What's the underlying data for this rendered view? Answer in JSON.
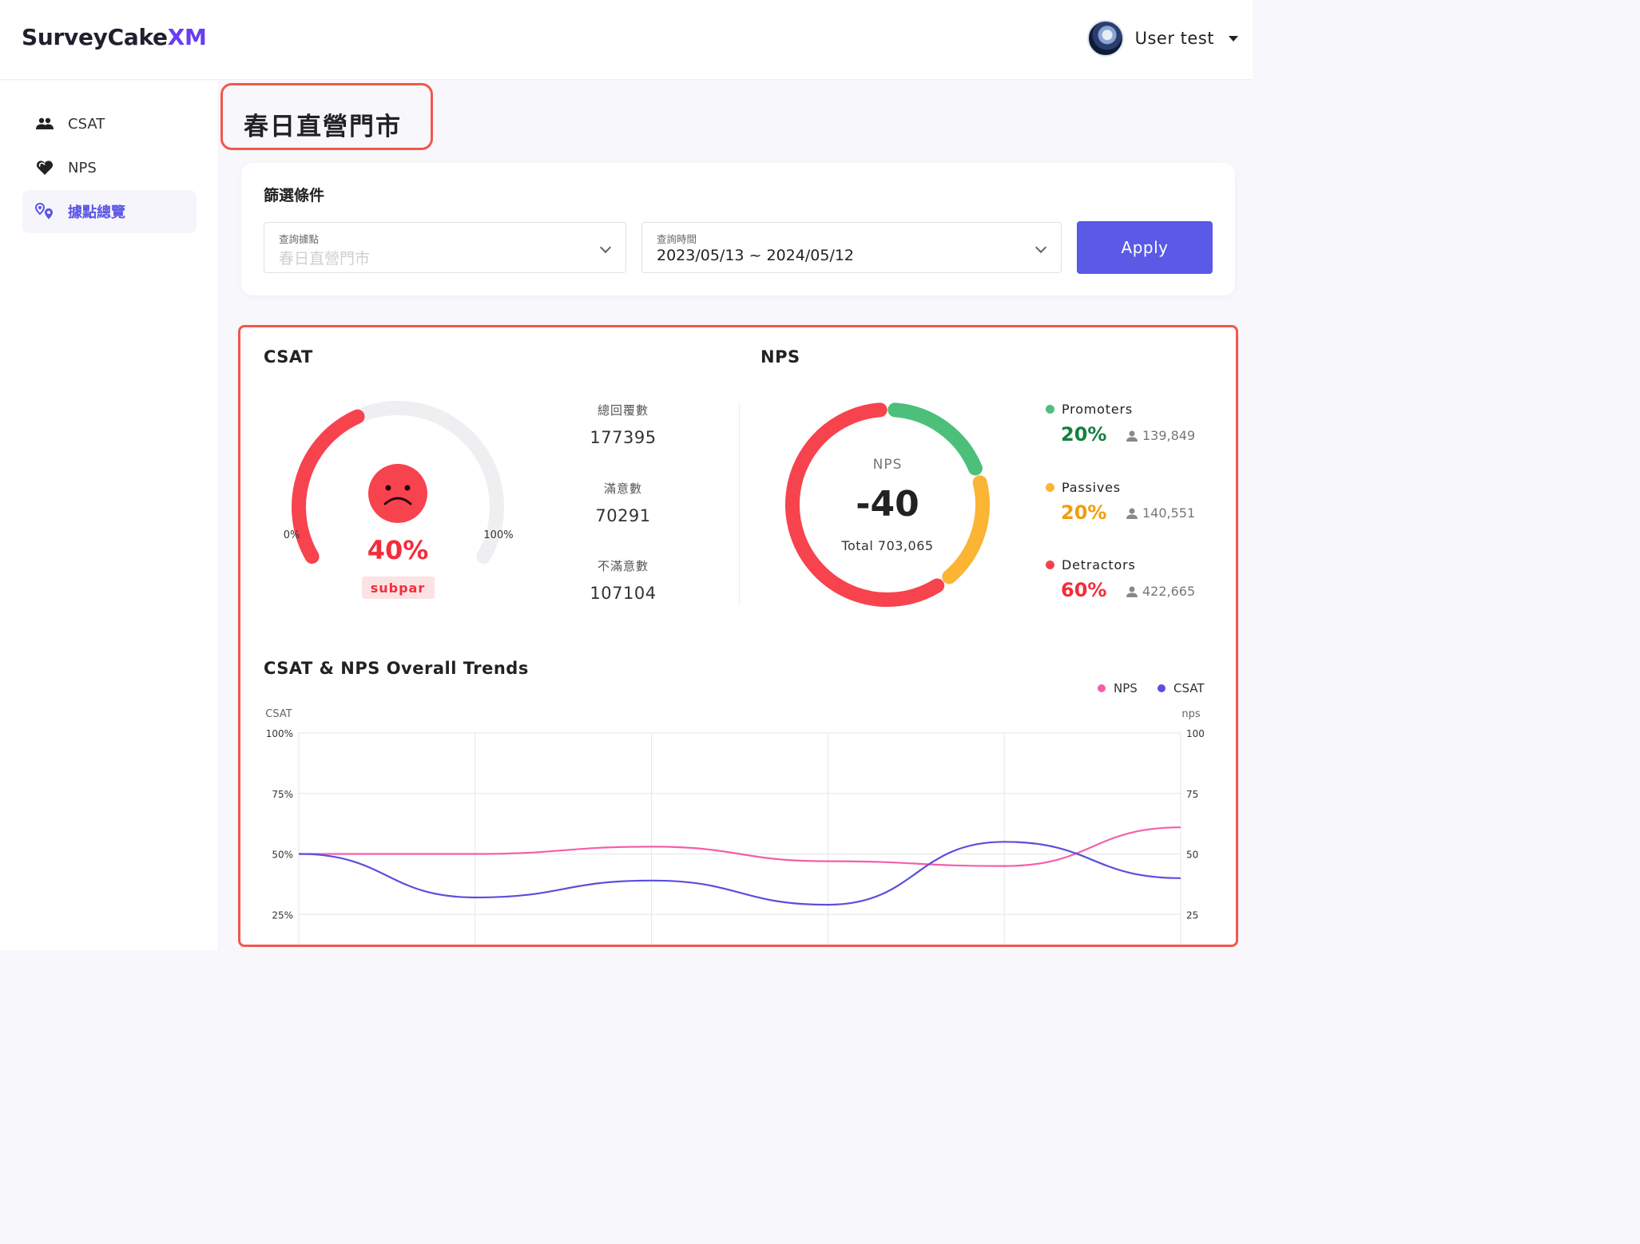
{
  "header": {
    "logo_main": "SurveyCake",
    "logo_accent": "XM",
    "user_name": "User test"
  },
  "sidebar": {
    "items": [
      {
        "label": "CSAT",
        "icon": "people-icon"
      },
      {
        "label": "NPS",
        "icon": "heart-icon"
      },
      {
        "label": "據點總覽",
        "icon": "location-pins-icon",
        "active": true
      }
    ]
  },
  "page": {
    "title": "春日直營門市"
  },
  "filter": {
    "title": "篩選條件",
    "location_label": "查詢據點",
    "location_placeholder": "春日直營門市",
    "date_label": "查詢時間",
    "date_value": "2023/05/13 ~ 2024/05/12",
    "apply_label": "Apply"
  },
  "csat": {
    "title": "CSAT",
    "gauge_fraction": 0.4,
    "gauge_min_label": "0%",
    "gauge_max_label": "100%",
    "percent": "40%",
    "rating": "subpar",
    "total_label": "總回覆數",
    "total_value": "177395",
    "satisfied_label": "滿意數",
    "satisfied_value": "70291",
    "unsatisfied_label": "不滿意數",
    "unsatisfied_value": "107104"
  },
  "nps": {
    "title": "NPS",
    "center_label": "NPS",
    "score": "-40",
    "total": "Total 703,065",
    "segments": [
      {
        "name": "Promoters",
        "percent": "20%",
        "count": "139,849",
        "share": 0.2,
        "color": "#4cbf7a",
        "text_color": "#13803f"
      },
      {
        "name": "Passives",
        "percent": "20%",
        "count": "140,551",
        "share": 0.2,
        "color": "#fbb433",
        "text_color": "#f29d0b"
      },
      {
        "name": "Detractors",
        "percent": "60%",
        "count": "422,665",
        "share": 0.6,
        "color": "#f7434e",
        "text_color": "#f52c3b"
      }
    ]
  },
  "chart_data": {
    "type": "line",
    "title": "CSAT & NPS Overall Trends",
    "left_axis_label": "CSAT",
    "right_axis_label": "nps",
    "left_ticks": [
      "100%",
      "75%",
      "50%",
      "25%"
    ],
    "right_ticks": [
      "100",
      "75",
      "50",
      "25"
    ],
    "ylim": [
      0,
      100
    ],
    "grid": true,
    "legend_position": "top-right",
    "x": [
      0,
      1,
      2,
      3,
      4,
      5
    ],
    "series": [
      {
        "name": "NPS",
        "color": "#f45fa8",
        "values": [
          50,
          50,
          53,
          47,
          45,
          61
        ]
      },
      {
        "name": "CSAT",
        "color": "#5a4fdc",
        "values": [
          50,
          32,
          39,
          29,
          55,
          40
        ]
      }
    ]
  }
}
